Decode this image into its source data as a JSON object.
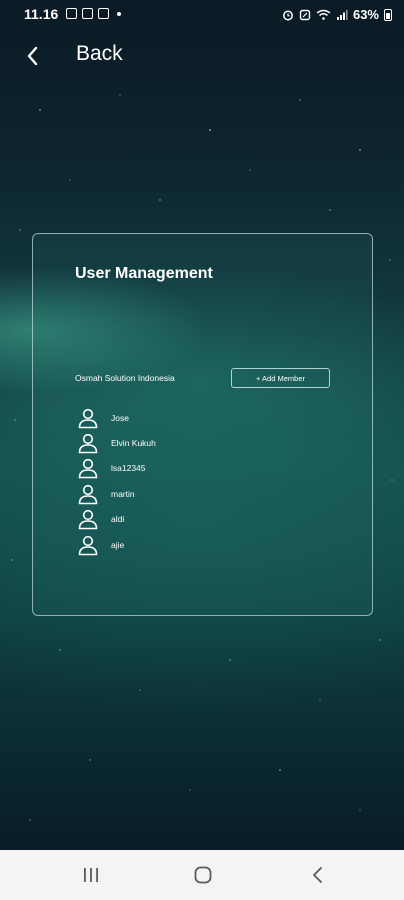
{
  "status_bar": {
    "time": "11.16",
    "battery": "63%"
  },
  "header": {
    "back_label": "Back"
  },
  "card": {
    "title": "User Management",
    "organization": "Osmah Solution Indonesia",
    "add_member_label": "+ Add Member",
    "members": [
      {
        "name": "Jose"
      },
      {
        "name": "Elvin Kukuh"
      },
      {
        "name": "lsa12345"
      },
      {
        "name": "martin"
      },
      {
        "name": "aldi"
      },
      {
        "name": "ajie"
      }
    ]
  },
  "icons": {
    "back": "arrow-left-icon",
    "member": "user-icon",
    "nav_recents": "recents-icon",
    "nav_home": "home-icon",
    "nav_back": "back-chevron-icon"
  },
  "colors": {
    "text": "#ffffff",
    "card_border": "#d2ebe6",
    "nav_bar": "#f4f4f4",
    "nav_icons": "#5a5a5a"
  }
}
